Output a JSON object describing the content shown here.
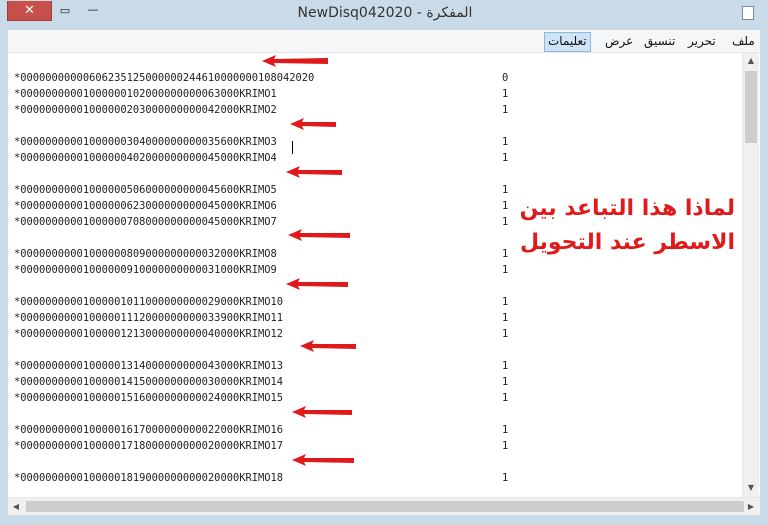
{
  "window": {
    "title": "NewDisq042020 - المفكرة",
    "close_glyph": "✕",
    "maximize_glyph": "▭",
    "minimize_glyph": "—"
  },
  "menu": {
    "items": [
      {
        "label": "ملف"
      },
      {
        "label": "تحرير"
      },
      {
        "label": "تنسيق"
      },
      {
        "label": "عرض"
      },
      {
        "label": "تعليمات"
      }
    ]
  },
  "document": {
    "lines": [
      {
        "text": "*00000000000606235125000000244610000000108042020",
        "qty": "0"
      },
      {
        "text": "*00000000001000000102000000000063000KRIMO1",
        "qty": "1"
      },
      {
        "text": "*00000000001000000203000000000042000KRIMO2",
        "qty": "1"
      },
      {
        "text": "*00000000001000000304000000000035600KRIMO3",
        "qty": "1"
      },
      {
        "text": "*00000000001000000402000000000045000KRIMO4",
        "qty": "1"
      },
      {
        "text": "*00000000001000000506000000000045600KRIMO5",
        "qty": "1"
      },
      {
        "text": "*00000000001000000623000000000045000KRIMO6",
        "qty": "1"
      },
      {
        "text": "*00000000001000000708000000000045000KRIMO7",
        "qty": "1"
      },
      {
        "text": "*00000000001000000809000000000032000KRIMO8",
        "qty": "1"
      },
      {
        "text": "*00000000001000000910000000000031000KRIMO9",
        "qty": "1"
      },
      {
        "text": "*00000000001000001011000000000029000KRIMO10",
        "qty": "1"
      },
      {
        "text": "*00000000001000001112000000000033900KRIMO11",
        "qty": "1"
      },
      {
        "text": "*00000000001000001213000000000040000KRIMO12",
        "qty": "1"
      },
      {
        "text": "*00000000001000001314000000000043000KRIMO13",
        "qty": "1"
      },
      {
        "text": "*00000000001000001415000000000030000KRIMO14",
        "qty": "1"
      },
      {
        "text": "*00000000001000001516000000000024000KRIMO15",
        "qty": "1"
      },
      {
        "text": "*00000000001000001617000000000022000KRIMO16",
        "qty": "1"
      },
      {
        "text": "*00000000001000001718000000000020000KRIMO17",
        "qty": "1"
      },
      {
        "text": "*00000000001000001819000000000020000KRIMO18",
        "qty": "1"
      }
    ]
  },
  "annotation": {
    "line1": "لماذا هذا التباعد بين",
    "line2": "الاسطر عند التحويل",
    "color": "#e01a1a"
  },
  "scrollbars": {
    "up_glyph": "▲",
    "down_glyph": "▼",
    "left_glyph": "◀",
    "right_glyph": "▶"
  }
}
